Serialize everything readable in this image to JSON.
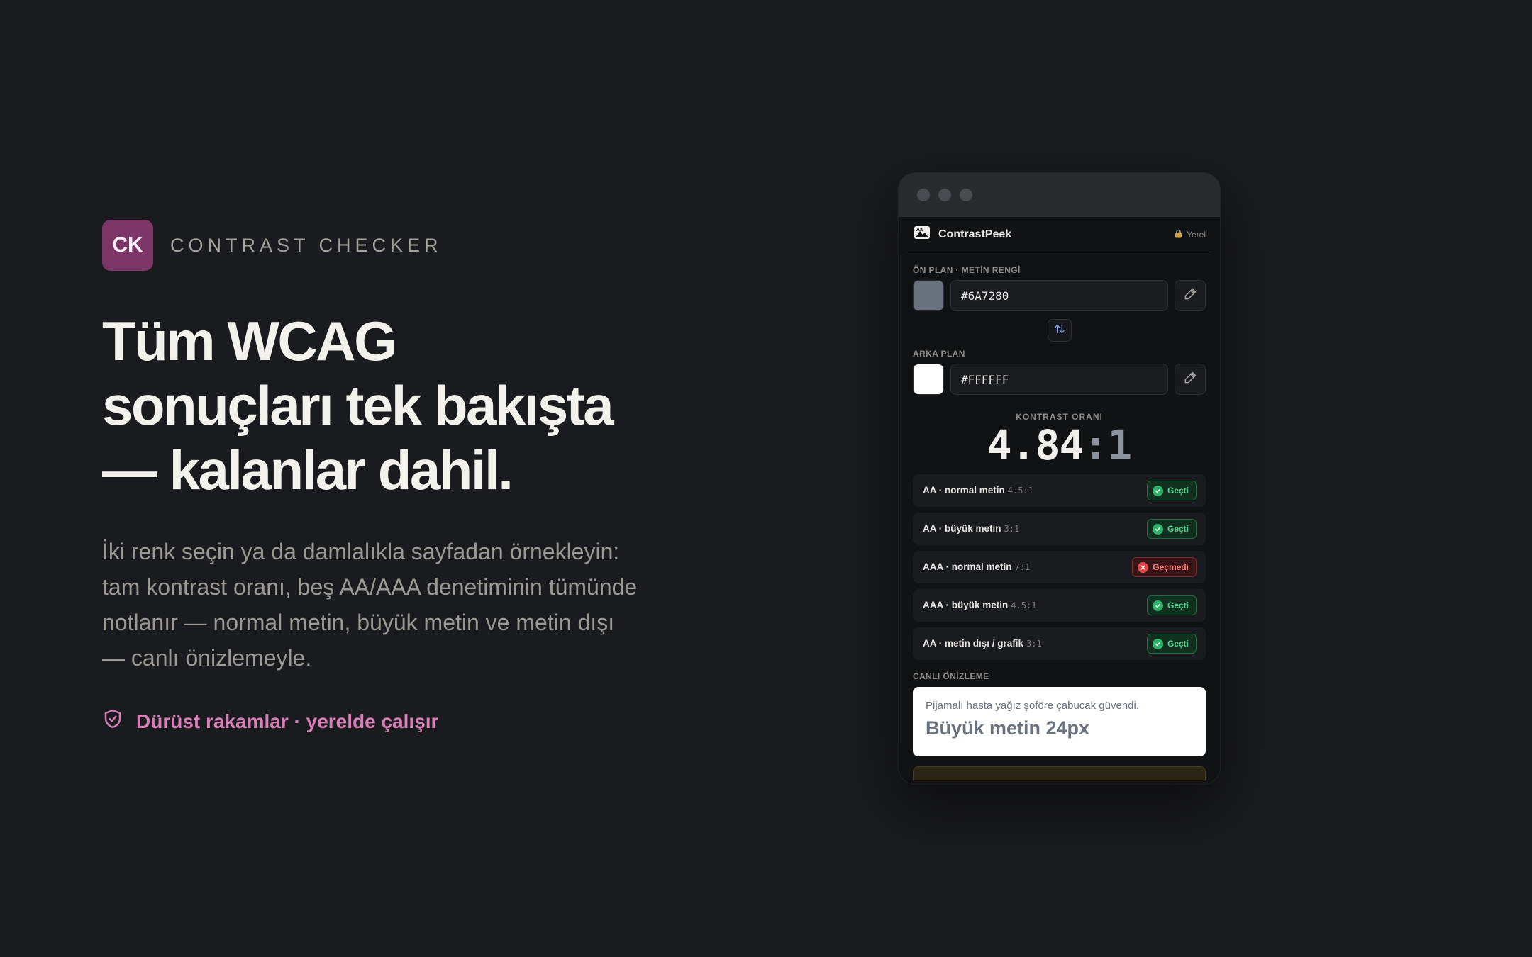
{
  "brand": {
    "badge": "CK",
    "name": "CONTRAST CHECKER",
    "badge_color": "#7b3566"
  },
  "hero": {
    "headline_lines": [
      "Tüm WCAG",
      "sonuçları tek bakışta",
      "— kalanlar dahil."
    ],
    "subtitle": "İki renk seçin ya da damlalıkla sayfadan örnekleyin: tam kontrast oranı, beş AA/AAA denetiminin tümünde notlanır — normal metin, büyük metin ve metin dışı — canlı önizlemeyle.",
    "tagline": "Dürüst rakamlar · yerelde çalışır",
    "tagline_icon": "shield-check-icon"
  },
  "app": {
    "title": "ContrastPeek",
    "local_label": "Yerel",
    "foreground": {
      "label": "ÖN PLAN · METİN RENGİ",
      "hex": "#6A7280",
      "swatch": "#6a7280"
    },
    "background": {
      "label": "ARKA PLAN",
      "hex": "#FFFFFF",
      "swatch": "#ffffff"
    },
    "ratio": {
      "label": "KONTRAST ORANI",
      "value": "4.84",
      "suffix": ":1"
    },
    "checks": [
      {
        "name": "AA · normal metin",
        "req": "4.5:1",
        "status": "Geçti",
        "pass": true
      },
      {
        "name": "AA · büyük metin",
        "req": "3:1",
        "status": "Geçti",
        "pass": true
      },
      {
        "name": "AAA · normal metin",
        "req": "7:1",
        "status": "Geçmedi",
        "pass": false
      },
      {
        "name": "AAA · büyük metin",
        "req": "4.5:1",
        "status": "Geçti",
        "pass": true
      },
      {
        "name": "AA · metin dışı / grafik",
        "req": "3:1",
        "status": "Geçti",
        "pass": true
      }
    ],
    "preview": {
      "label": "CANLI ÖNİZLEME",
      "small_text": "Pijamalı hasta yağız şoföre çabucak güvendi.",
      "large_text": "Büyük metin 24px"
    }
  }
}
